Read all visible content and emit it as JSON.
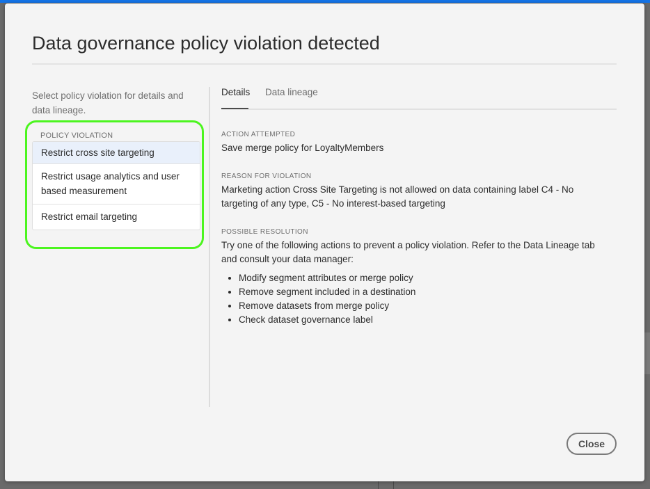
{
  "colors": {
    "accent": "#1473e6",
    "highlight": "#4cf51f"
  },
  "dialog": {
    "title": "Data governance policy violation detected",
    "intro": "Select policy violation for details and data lineage.",
    "group_label": "POLICY VIOLATION",
    "violations": [
      {
        "label": "Restrict cross site targeting",
        "selected": true
      },
      {
        "label": "Restrict usage analytics and user based measurement",
        "selected": false
      },
      {
        "label": "Restrict email targeting",
        "selected": false
      }
    ],
    "tabs": [
      {
        "label": "Details",
        "active": true
      },
      {
        "label": "Data lineage",
        "active": false
      }
    ],
    "action_attempted": {
      "label": "ACTION ATTEMPTED",
      "text": "Save merge policy for LoyaltyMembers"
    },
    "reason": {
      "label": "REASON FOR VIOLATION",
      "text": "Marketing action Cross Site Targeting is not allowed on data containing label C4 - No targeting of any type, C5 - No interest-based targeting"
    },
    "resolution": {
      "label": "POSSIBLE RESOLUTION",
      "text": "Try one of the following actions to prevent a policy violation. Refer to the Data Lineage tab and consult your data manager:",
      "items": [
        "Modify segment attributes or merge policy",
        "Remove segment included in a destination",
        "Remove datasets from merge policy",
        "Check dataset governance label"
      ]
    },
    "close_label": "Close"
  }
}
